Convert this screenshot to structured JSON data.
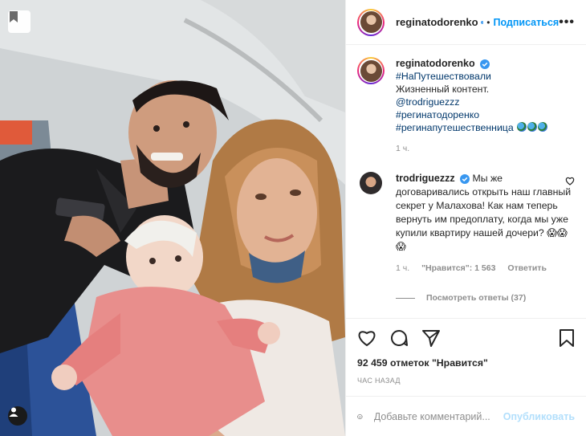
{
  "post": {
    "username": "reginatodorenko",
    "follow_label": "Подписаться",
    "dot": "•",
    "more_label": "•••"
  },
  "caption": {
    "username": "reginatodorenko",
    "lines": [
      "#НаПутешествовали",
      "Жизненный контент.",
      "@trodriguezzz",
      "#регинатодоренко",
      "#регинапутешественница"
    ],
    "time": "1 ч."
  },
  "comment": {
    "username": "trodriguezzz",
    "text": "Мы же договаривались открыть наш главный секрет у Малахова! Как нам теперь вернуть им предоплату, когда мы уже купили квартиру нашей дочери? 😱😱😱",
    "time": "1 ч.",
    "likes": "\"Нравится\": 1 563",
    "reply": "Ответить",
    "view_replies": "Посмотреть ответы (37)"
  },
  "stats": {
    "likes": "92 459 отметок \"Нравится\"",
    "ago": "ЧАС НАЗАД"
  },
  "add_comment": {
    "placeholder": "Добавьте комментарий...",
    "publish": "Опубликовать"
  },
  "colors": {
    "accent": "#0095f6",
    "muted": "#8e8e8e",
    "link": "#00376b",
    "publish_disabled": "#b2dffc",
    "verified": "#3897f0"
  }
}
